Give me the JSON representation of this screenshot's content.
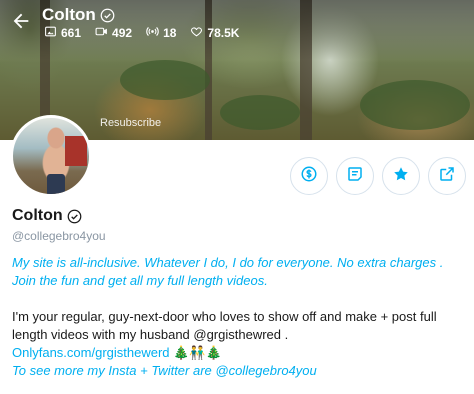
{
  "header": {
    "name": "Colton",
    "stats": {
      "photos": "661",
      "videos": "492",
      "streams": "18",
      "likes": "78.5K"
    },
    "resubscribe": "Resubscribe"
  },
  "profile": {
    "name": "Colton",
    "handle": "@collegebro4you"
  },
  "bio": {
    "line1": "My site is all-inclusive. Whatever I do, I do for everyone. No extra charges . Join the fun and get all my full length videos.",
    "line2": "I'm your regular, guy-next-door who loves to show off and make + post full length videos with my husband @grgisthewred .",
    "link": "Onlyfans.com/grgisthewerd",
    "emoji": "🎄👬🎄",
    "line4": "To see more my Insta + Twitter are @collegebro4you"
  },
  "colors": {
    "accent": "#00aff0",
    "muted": "#8a96a3"
  },
  "icons": [
    "back-arrow-icon",
    "verified-icon",
    "photo-icon",
    "video-icon",
    "stream-icon",
    "heart-icon",
    "dollar-icon",
    "message-icon",
    "star-icon",
    "share-icon"
  ]
}
